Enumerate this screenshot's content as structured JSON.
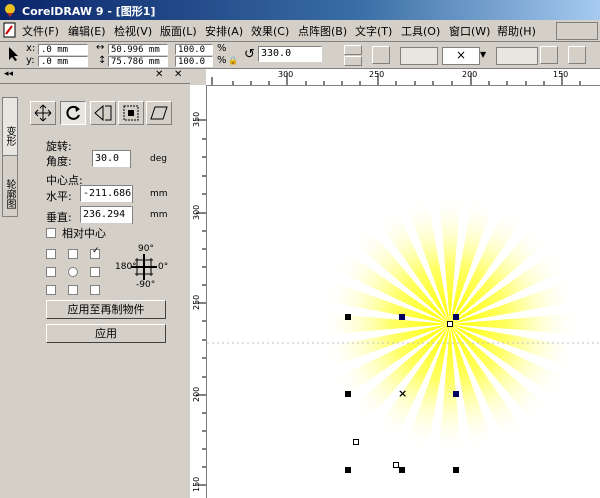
{
  "window": {
    "title": "CorelDRAW 9 - [图形1]"
  },
  "menu": {
    "items": [
      "文件(F)",
      "编辑(E)",
      "检视(V)",
      "版面(L)",
      "安排(A)",
      "效果(C)",
      "点阵图(B)",
      "文字(T)",
      "工具(O)",
      "窗口(W)",
      "帮助(H)"
    ]
  },
  "propbar": {
    "x_label": "x:",
    "x_value": ".0 mm",
    "y_label": "y:",
    "y_value": ".0 mm",
    "w_value": "50.996 mm",
    "h_value": "75.786 mm",
    "sx_value": "100.0",
    "sy_value": "100.0",
    "pct1": "%",
    "pct2": "%",
    "angle_value": "330.0",
    "outline_value": "×"
  },
  "docker": {
    "tabs": [
      "变形",
      "轮廓图"
    ],
    "section_rotate": "旋转:",
    "angle_label": "角度:",
    "angle_value": "30.0",
    "angle_unit": "deg",
    "center_label": "中心点:",
    "h_label": "水平:",
    "h_value": "-211.686",
    "h_unit": "mm",
    "v_label": "垂直:",
    "v_value": "236.294",
    "v_unit": "mm",
    "relative_label": "相对中心",
    "deg_top": "90°",
    "deg_left": "180°",
    "deg_right": "0°",
    "deg_bottom": "-90°",
    "apply_copy_label": "应用至再制物件",
    "apply_label": "应用"
  },
  "rulers": {
    "h_ticks": [
      "300",
      "250",
      "200",
      "150"
    ],
    "v_ticks": [
      "350",
      "300",
      "250",
      "200",
      "150"
    ]
  },
  "colors": {
    "sun_ray": "#ffff00",
    "title_blue": "#0a246a"
  }
}
